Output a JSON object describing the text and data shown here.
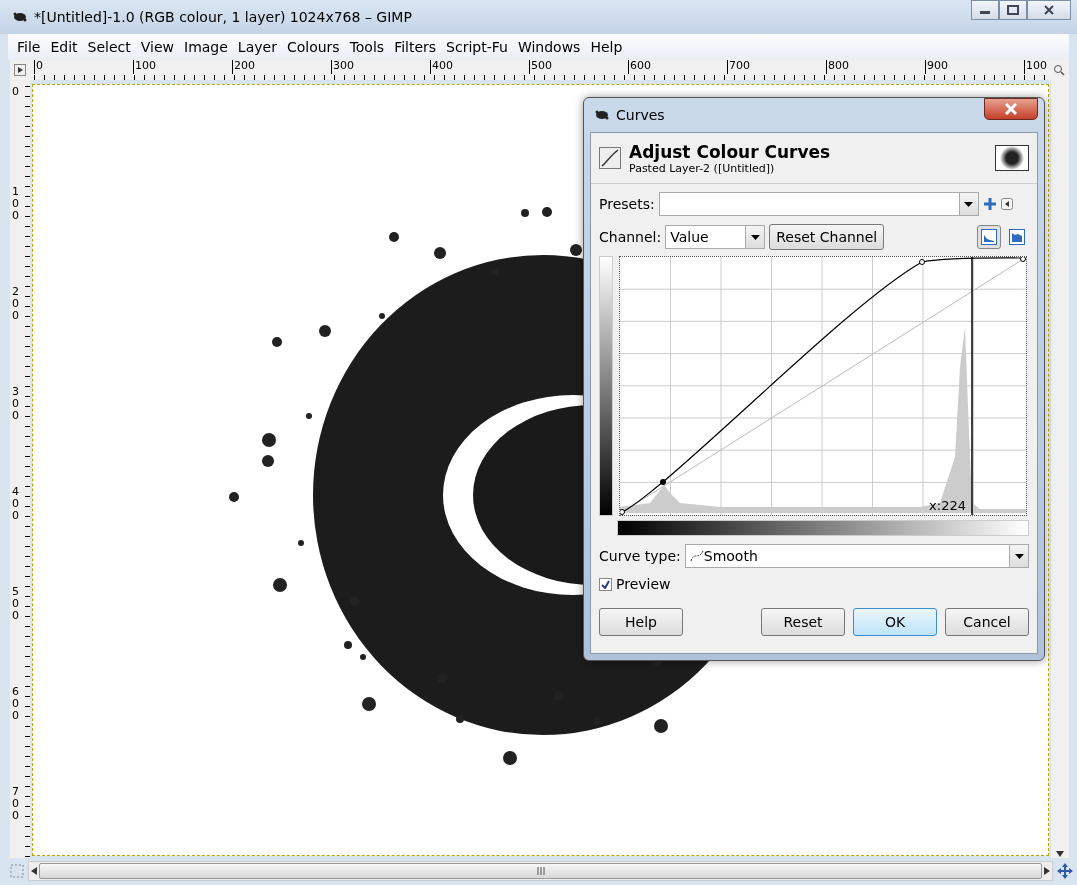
{
  "window": {
    "title": "*[Untitled]-1.0 (RGB colour, 1 layer) 1024x768 – GIMP"
  },
  "menu": [
    "File",
    "Edit",
    "Select",
    "View",
    "Image",
    "Layer",
    "Colours",
    "Tools",
    "Filters",
    "Script-Fu",
    "Windows",
    "Help"
  ],
  "ruler_h": [
    "0",
    "100",
    "200",
    "300",
    "400",
    "500",
    "600",
    "700",
    "800",
    "900",
    "100"
  ],
  "ruler_v": [
    "0",
    "100",
    "200",
    "300",
    "400",
    "500",
    "600",
    "700"
  ],
  "dialog": {
    "title": "Curves",
    "heading": "Adjust Colour Curves",
    "subheading": "Pasted Layer-2 ([Untitled])",
    "presets": {
      "label": "Presets:"
    },
    "channel": {
      "label": "Channel:",
      "value": "Value"
    },
    "reset_channel": "Reset Channel",
    "histogram_scale": [
      {
        "kind": "linear",
        "selected": true
      },
      {
        "kind": "log",
        "selected": false
      }
    ],
    "curve": {
      "readout": "x:224"
    },
    "curve_type": {
      "label": "Curve type:",
      "value": "Smooth"
    },
    "preview": {
      "label": "Preview",
      "checked": true
    },
    "buttons": [
      {
        "label": "Help",
        "focused": false
      },
      {
        "label": "Reset",
        "focused": false
      },
      {
        "label": "OK",
        "focused": true
      },
      {
        "label": "Cancel",
        "focused": false
      }
    ]
  }
}
